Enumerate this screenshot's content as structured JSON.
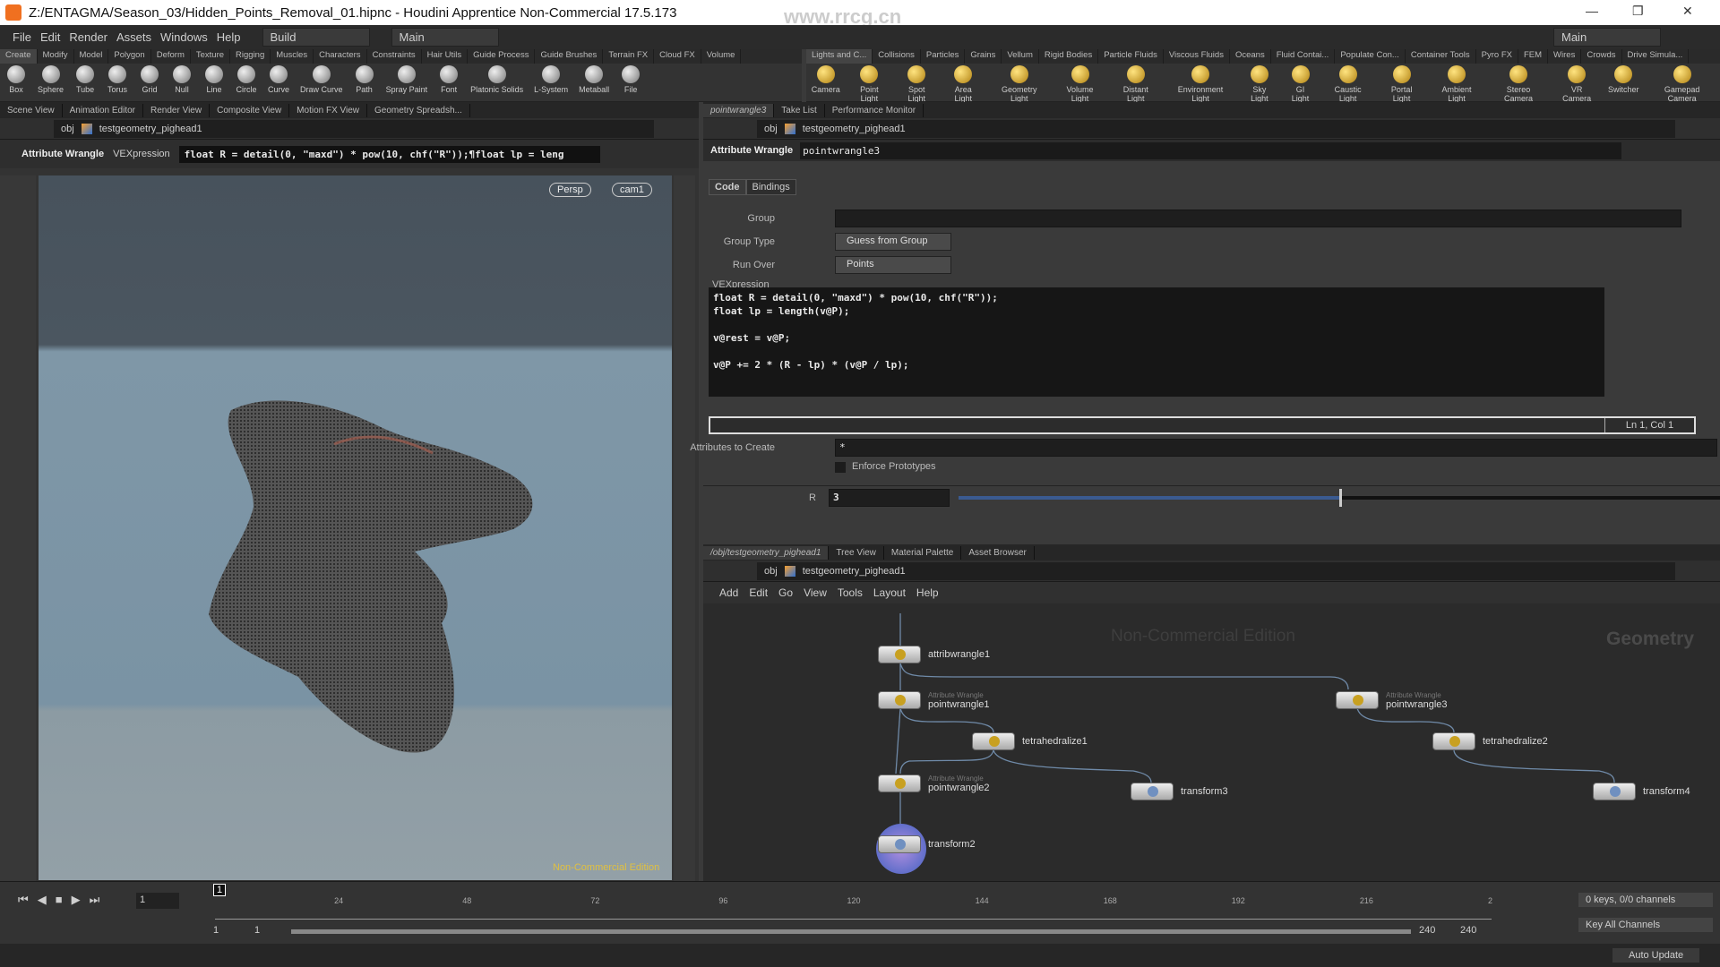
{
  "window": {
    "title": "Z:/ENTAGMA/Season_03/Hidden_Points_Removal_01.hipnc - Houdini Apprentice Non-Commercial 17.5.173",
    "watermark_top": "www.rrcg.cn"
  },
  "menu": {
    "items": [
      "File",
      "Edit",
      "Render",
      "Assets",
      "Windows",
      "Help"
    ],
    "desktop": "Build",
    "desktop_right": "Main",
    "main_left": "Main"
  },
  "shelf_left": {
    "tabs": [
      "Create",
      "Modify",
      "Model",
      "Polygon",
      "Deform",
      "Texture",
      "Rigging",
      "Muscles",
      "Characters",
      "Constraints",
      "Hair Utils",
      "Guide Process",
      "Guide Brushes",
      "Terrain FX",
      "Cloud FX",
      "Volume"
    ],
    "tools": [
      "Box",
      "Sphere",
      "Tube",
      "Torus",
      "Grid",
      "Null",
      "Line",
      "Circle",
      "Curve",
      "Draw Curve",
      "Path",
      "Spray Paint",
      "Font",
      "Platonic Solids",
      "L-System",
      "Metaball",
      "File"
    ]
  },
  "shelf_right": {
    "tabs": [
      "Lights and C...",
      "Collisions",
      "Particles",
      "Grains",
      "Vellum",
      "Rigid Bodies",
      "Particle Fluids",
      "Viscous Fluids",
      "Oceans",
      "Fluid Contai...",
      "Populate Con...",
      "Container Tools",
      "Pyro FX",
      "FEM",
      "Wires",
      "Crowds",
      "Drive Simula..."
    ],
    "tools": [
      "Camera",
      "Point Light",
      "Spot Light",
      "Area Light",
      "Geometry Light",
      "Volume Light",
      "Distant Light",
      "Environment Light",
      "Sky Light",
      "GI Light",
      "Caustic Light",
      "Portal Light",
      "Ambient Light",
      "Stereo Camera",
      "VR Camera",
      "Switcher",
      "Gamepad Camera"
    ]
  },
  "left_pane": {
    "tabs": [
      "Scene View",
      "Animation Editor",
      "Render View",
      "Composite View",
      "Motion FX View",
      "Geometry Spreadsh..."
    ],
    "path": [
      "obj",
      "testgeometry_pighead1"
    ],
    "op_type": "Attribute Wrangle",
    "op_param": "VEXpression",
    "op_value": "float R = detail(0, \"maxd\") * pow(10, chf(\"R\"));¶float lp = leng",
    "view_mode": "Persp",
    "camera": "cam1",
    "nc_label": "Non-Commercial Edition"
  },
  "param_pane": {
    "tabs": [
      "pointwrangle3",
      "Take List",
      "Performance Monitor"
    ],
    "path": [
      "obj",
      "testgeometry_pighead1"
    ],
    "node_type": "Attribute Wrangle",
    "node_name": "pointwrangle3",
    "subtabs": [
      "Code",
      "Bindings"
    ],
    "group_label": "Group",
    "group_value": "",
    "group_type_label": "Group Type",
    "group_type": "Guess from Group",
    "run_over_label": "Run Over",
    "run_over": "Points",
    "vex_label": "VEXpression",
    "code_lines": [
      "float R = detail(0, \"maxd\") * pow(10, chf(\"R\"));",
      "float lp = length(v@P);",
      "",
      "v@rest = v@P;",
      "",
      "v@P += 2 * (R - lp) * (v@P / lp);"
    ],
    "cursor": "Ln 1, Col 1",
    "attrs_label": "Attributes to Create",
    "attrs_value": "*",
    "enforce_label": "Enforce Prototypes",
    "enforce_checked": false,
    "r_label": "R",
    "r_value": "3",
    "r_slider_fraction": 0.5
  },
  "network": {
    "tabs": [
      "/obj/testgeometry_pighead1",
      "Tree View",
      "Material Palette",
      "Asset Browser"
    ],
    "path": [
      "obj",
      "testgeometry_pighead1"
    ],
    "menu": [
      "Add",
      "Edit",
      "Go",
      "View",
      "Tools",
      "Layout",
      "Help"
    ],
    "watermark": "Non-Commercial Edition",
    "context": "Geometry",
    "nodes": [
      {
        "name": "attribwrangle1",
        "type": ""
      },
      {
        "name": "pointwrangle1",
        "type": "Attribute Wrangle"
      },
      {
        "name": "tetrahedralize1",
        "type": ""
      },
      {
        "name": "pointwrangle2",
        "type": "Attribute Wrangle"
      },
      {
        "name": "transform2",
        "type": ""
      },
      {
        "name": "transform3",
        "type": ""
      },
      {
        "name": "pointwrangle3",
        "type": "Attribute Wrangle"
      },
      {
        "name": "tetrahedralize2",
        "type": ""
      },
      {
        "name": "transform4",
        "type": ""
      }
    ]
  },
  "timeline": {
    "frame": "1",
    "ticks": [
      "24",
      "48",
      "72",
      "96",
      "120",
      "144",
      "168",
      "192",
      "216",
      "2"
    ],
    "current_marker": "1",
    "range_start": "1",
    "range_start2": "1",
    "range_end": "240",
    "range_end2": "240",
    "keys": "0 keys, 0/0 channels",
    "key_mode": "Key All Channels",
    "update": "Auto Update"
  }
}
